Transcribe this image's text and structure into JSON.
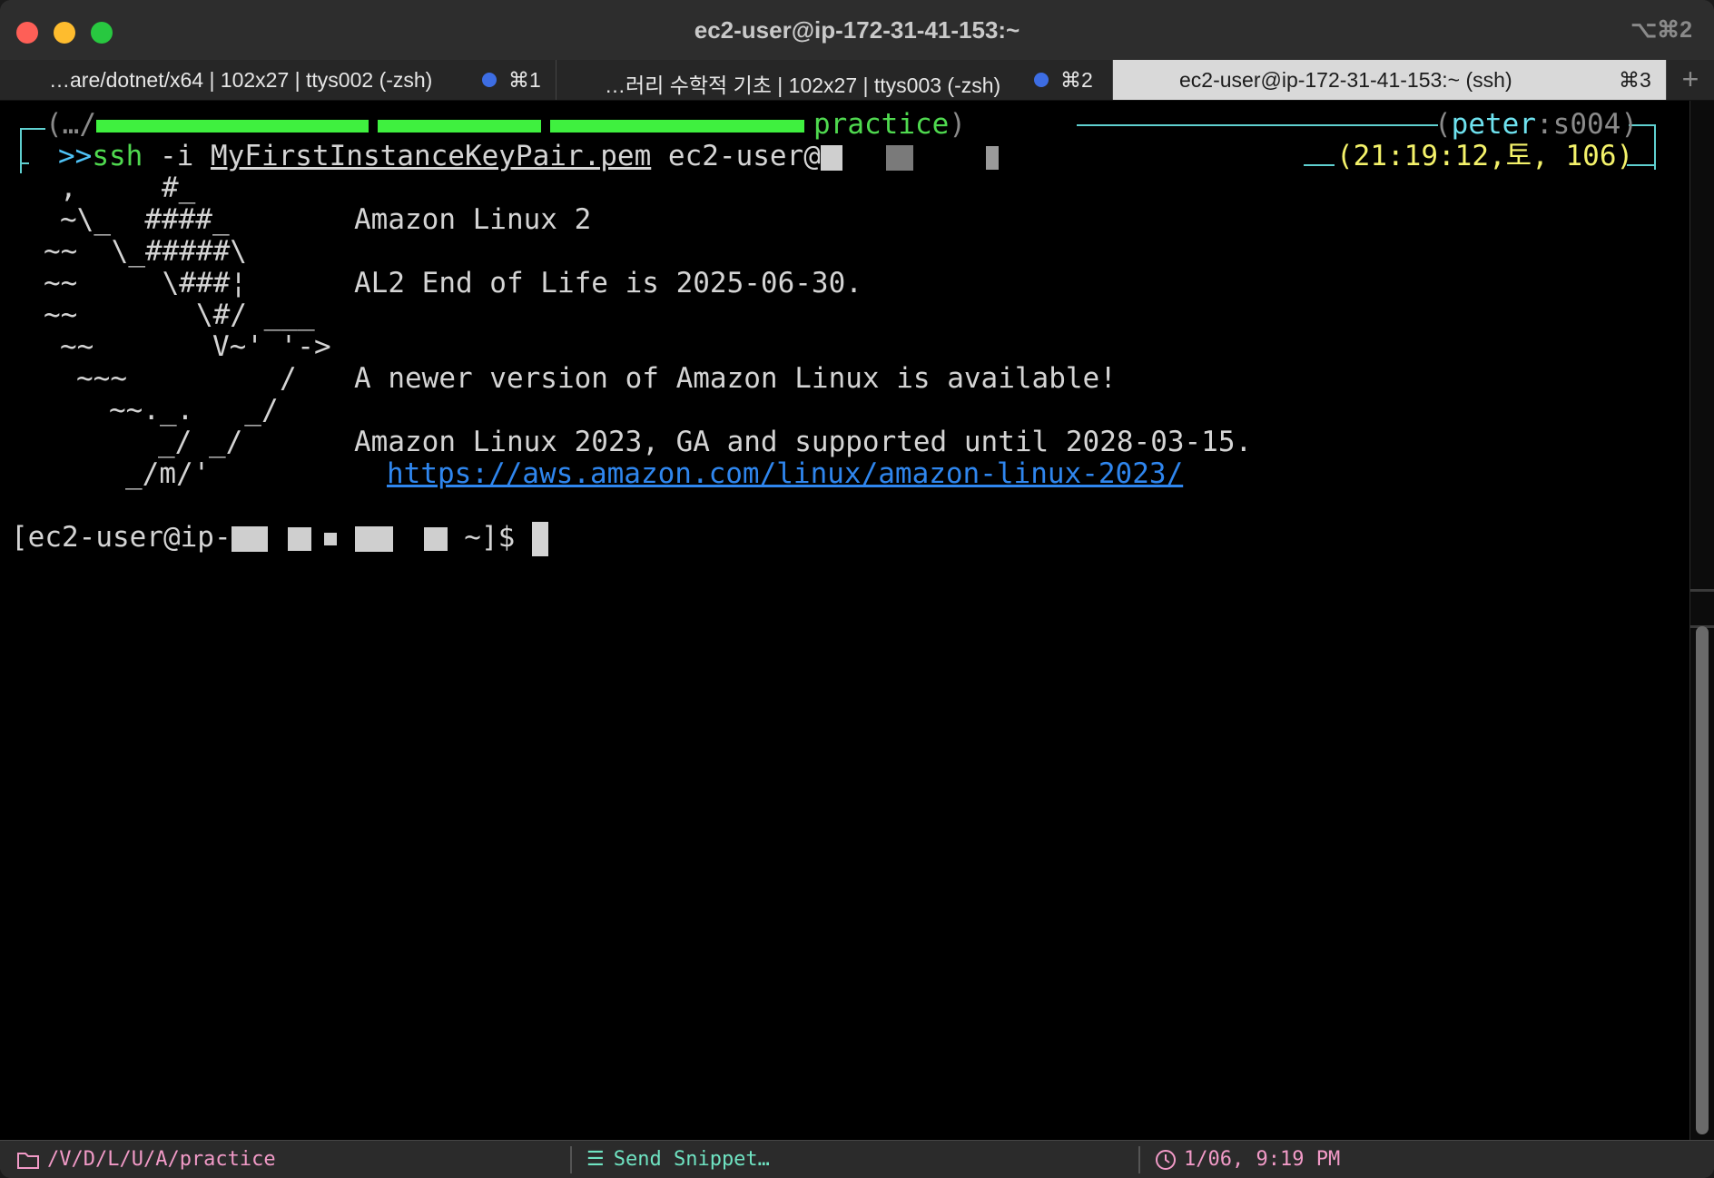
{
  "window": {
    "title": "ec2-user@ip-172-31-41-153:~",
    "shortcut": "⌥⌘2"
  },
  "tabs": [
    {
      "label": "…are/dotnet/x64 | 102x27 | ttys002 (-zsh)",
      "shortcut": "⌘1",
      "active": false
    },
    {
      "label": "…러리 수학적 기초 | 102x27 | ttys003 (-zsh)",
      "shortcut": "⌘2",
      "active": false
    },
    {
      "label": "ec2-user@ip-172-31-41-153:~ (ssh)",
      "shortcut": "⌘3",
      "active": true
    }
  ],
  "prompt": {
    "path_prefix": "(…/",
    "dir": "practice",
    "user": "peter",
    "sep": ":",
    "session": "s004",
    "marker": ">>",
    "cmd": "ssh",
    "args_flag": " -i ",
    "keyfile": "MyFirstInstanceKeyPair.pem",
    "target": " ec2-user@",
    "time": "21:19:12,토, 106"
  },
  "motd": {
    "art": [
      ",     #_",
      "~\\_  ####_",
      "~~  \\_#####\\",
      "~~     \\###¦",
      "~~       \\#/ ___",
      "~~       V~' '->",
      "~~~         /",
      "~~._.   _/",
      "_/ _/",
      "_/m/'"
    ],
    "line1": "Amazon Linux 2",
    "line2": "AL2 End of Life is 2025-06-30.",
    "line3": "A newer version of Amazon Linux is available!",
    "line4": "Amazon Linux 2023, GA and supported until 2028-03-15.",
    "link": "https://aws.amazon.com/linux/amazon-linux-2023/"
  },
  "shell": {
    "prefix": "[ec2-user@ip-",
    "suffix": " ~]$ "
  },
  "statusbar": {
    "path": "/V/D/L/U/A/practice",
    "snippet": "Send Snippet…",
    "clock": "1/06, 9:19 PM"
  }
}
